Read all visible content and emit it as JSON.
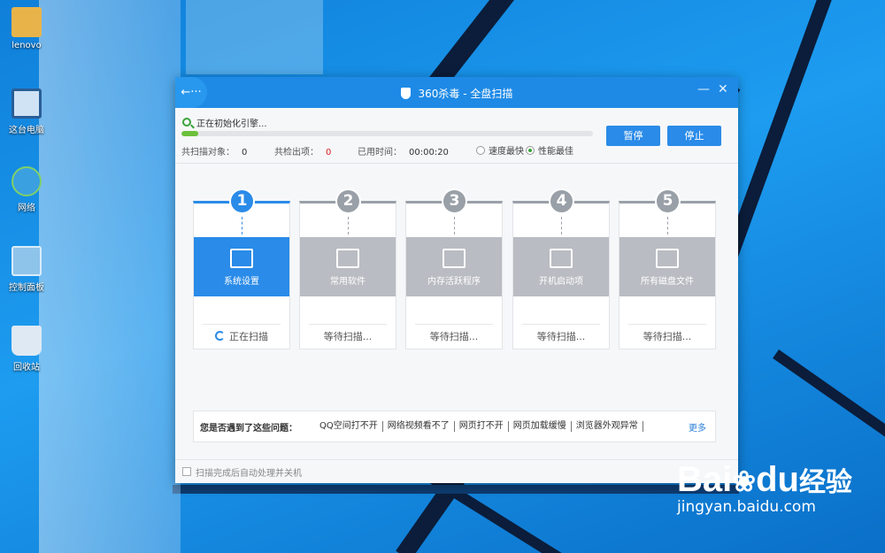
{
  "desktop": {
    "icons": [
      {
        "label": "lenovo",
        "icon": "folder-user-icon",
        "color": "#e8b44a"
      },
      {
        "label": "这台电脑",
        "icon": "computer-icon",
        "color": "#cfe3f5"
      },
      {
        "label": "网络",
        "icon": "network-globe-icon",
        "color": "#3aa0e0"
      },
      {
        "label": "控制面板",
        "icon": "control-panel-icon",
        "color": "#8fc4ea"
      },
      {
        "label": "回收站",
        "icon": "recycle-bin-icon",
        "color": "#dfe9f3"
      }
    ]
  },
  "window": {
    "title": "360杀毒 - 全盘扫描",
    "back_icon": "←···",
    "minimize_icon": "—",
    "close_icon": "✕"
  },
  "status": {
    "message": "正在初始化引擎...",
    "progress_percent": 4,
    "scanned_label": "共扫描对象：",
    "scanned_value": "0",
    "found_label": "共检出项：",
    "found_value": "0",
    "time_label": "已用时间：",
    "time_value": "00:00:20",
    "speed_option": "速度最快",
    "performance_option": "性能最佳",
    "selected_mode": "performance"
  },
  "buttons": {
    "pause": "暂停",
    "stop": "停止"
  },
  "steps": [
    {
      "num": "1",
      "label": "系统设置",
      "state": "正在扫描",
      "active": true,
      "icon": "windows-settings-icon"
    },
    {
      "num": "2",
      "label": "常用软件",
      "state": "等待扫描...",
      "active": false,
      "icon": "software-icon"
    },
    {
      "num": "3",
      "label": "内存活跃程序",
      "state": "等待扫描...",
      "active": false,
      "icon": "memory-icon"
    },
    {
      "num": "4",
      "label": "开机启动项",
      "state": "等待扫描...",
      "active": false,
      "icon": "startup-icon"
    },
    {
      "num": "5",
      "label": "所有磁盘文件",
      "state": "等待扫描...",
      "active": false,
      "icon": "disk-search-icon"
    }
  ],
  "issues": {
    "question": "您是否遇到了这些问题：",
    "links": [
      "QQ空间打不开",
      "网络视频看不了",
      "网页打不开",
      "网页加载缓慢",
      "浏览器外观异常"
    ],
    "more": "更多"
  },
  "footer": {
    "auto_shutdown": "扫描完成后自动处理并关机"
  },
  "watermark": {
    "main": "Bai",
    "main2": "du",
    "cn": "经验",
    "sub": "jingyan.baidu.com"
  }
}
